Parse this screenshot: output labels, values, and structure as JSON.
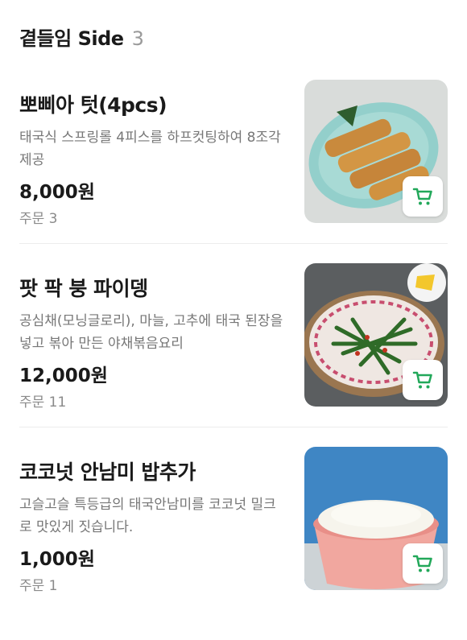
{
  "section": {
    "title": "곁들임 Side",
    "count": "3"
  },
  "items": [
    {
      "name": "뽀삐아 텃(4pcs)",
      "desc": "태국식 스프링롤 4피스를 하프컷팅하여 8조각 제공",
      "price": "8,000원",
      "orders": "주문 3",
      "icon": "cart-icon"
    },
    {
      "name": "팟 팍 붕 파이뎅",
      "desc": "공심채(모닝글로리), 마늘, 고추에 태국 된장을 넣고 볶아 만든 야채볶음요리",
      "price": "12,000원",
      "orders": "주문 11",
      "icon": "cart-icon"
    },
    {
      "name": "코코넛 안남미 밥추가",
      "desc": "고슬고슬 특등급의 태국안남미를 코코넛 밀크로 맛있게 짓습니다.",
      "price": "1,000원",
      "orders": "주문 1",
      "icon": "cart-icon"
    }
  ],
  "colors": {
    "accent": "#22a85a",
    "muted": "#777777"
  }
}
